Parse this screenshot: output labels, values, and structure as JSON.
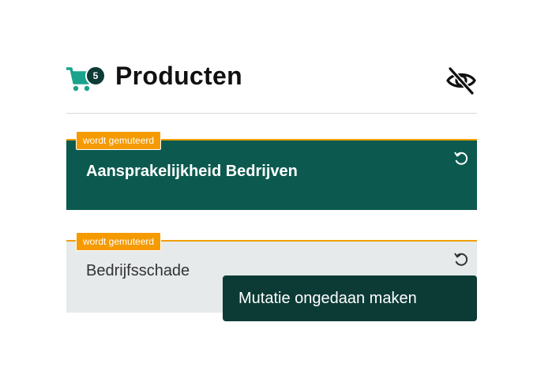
{
  "header": {
    "title": "Producten",
    "cart_count": "5",
    "cart_icon": "shopping-cart-icon",
    "visibility_icon": "eye-off-icon"
  },
  "products": [
    {
      "tag": "wordt gemuteerd",
      "name": "Aansprakelijkheid Bedrijven",
      "selected": true
    },
    {
      "tag": "wordt gemuteerd",
      "name": "Bedrijfsschade",
      "selected": false
    }
  ],
  "tooltip": {
    "text": "Mutatie ongedaan maken"
  },
  "colors": {
    "accent": "#f59a00",
    "selected_bg": "#0c5a4f",
    "unselected_bg": "#e6eaea",
    "tooltip_bg": "#0c3b36",
    "cart": "#1aa38c"
  }
}
